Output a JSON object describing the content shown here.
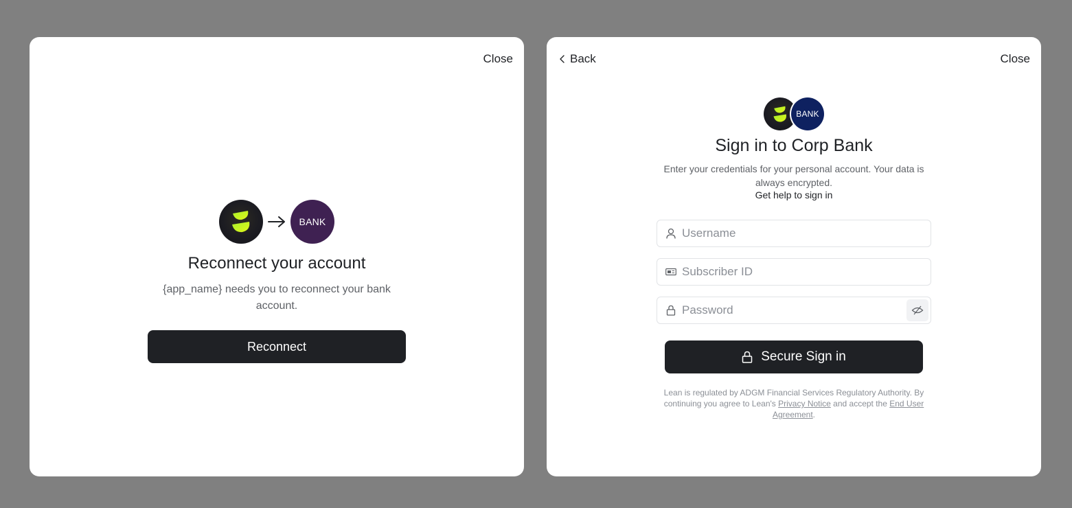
{
  "left_panel": {
    "close_label": "Close",
    "app_logo": "lean-app-logo",
    "bank_logo_label": "BANK",
    "bank_logo_color": "#3f2152",
    "arrow_icon": "arrow-right-icon",
    "title": "Reconnect your account",
    "description": "{app_name} needs you to reconnect your bank account.",
    "reconnect_label": "Reconnect"
  },
  "right_panel": {
    "back_label": "Back",
    "close_label": "Close",
    "bank_logo_label": "BANK",
    "bank_logo_color": "#0e2160",
    "title": "Sign in to Corp Bank",
    "description": "Enter your credentials for your personal account. Your data is always encrypted.",
    "help_link": "Get help to sign in",
    "fields": {
      "username": {
        "placeholder": "Username",
        "value": "",
        "icon": "user-icon"
      },
      "subscriber_id": {
        "placeholder": "Subscriber ID",
        "value": "",
        "icon": "id-card-icon"
      },
      "password": {
        "placeholder": "Password",
        "value": "",
        "icon": "lock-icon",
        "toggle_icon": "eye-off-icon"
      }
    },
    "signin_label": "Secure Sign in",
    "legal": {
      "prefix": "Lean is regulated by ADGM Financial Services Regulatory Authority. By continuing you agree to Lean's ",
      "privacy_link": "Privacy Notice",
      "middle": " and accept the ",
      "eula_link": "End User Agreement",
      "suffix": "."
    }
  },
  "colors": {
    "backdrop": "#808080",
    "primary_button": "#1f2125",
    "logo_accent": "#c6f31a"
  }
}
